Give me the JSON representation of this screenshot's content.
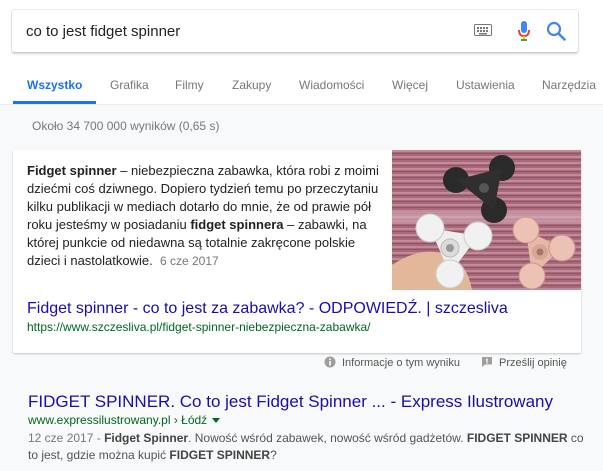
{
  "search": {
    "query": "co to jest fidget spinner"
  },
  "tabs": [
    {
      "label": "Wszystko"
    },
    {
      "label": "Grafika"
    },
    {
      "label": "Filmy"
    },
    {
      "label": "Zakupy"
    },
    {
      "label": "Wiadomości"
    },
    {
      "label": "Więcej"
    },
    {
      "label": "Ustawienia"
    },
    {
      "label": "Narzędzia"
    }
  ],
  "stats": "Około 34 700 000 wyników (0,65 s)",
  "featured": {
    "snippet_parts": {
      "b1": "Fidget spinner",
      "t1": " – niebezpieczna zabawka, która robi z moimi dziećmi coś dziwnego. Dopiero tydzień temu po przeczytaniu kilku publikacji w mediach dotarło do mnie, że od prawie pół roku jesteśmy w posiadaniu ",
      "b2": "fidget spinnera",
      "t2": " – zabawki, na której punkcie od niedawna są totalnie zakręcone polskie dzieci i nastolatkowie."
    },
    "date": "6 cze 2017",
    "title": "Fidget spinner - co to jest za zabawka? - ODPOWIEDŹ. | szczesliva",
    "url": "https://www.szczesliva.pl/fidget-spinner-niebezpieczna-zabawka/",
    "feedback_info": "Informacje o tym wyniku",
    "feedback_send": "Prześlij opinię"
  },
  "result2": {
    "title": "FIDGET SPINNER. Co to jest Fidget Spinner ... - Express Ilustrowany",
    "url": "www.expressilustrowany.pl › Łódź",
    "snippet": {
      "date": "12 cze 2017",
      "sep": " - ",
      "b1": "Fidget Spinner",
      "t1": ". Nowość wśród zabawek, nowość wśród gadżetów. ",
      "b2": "FIDGET SPINNER",
      "t2": " co to jest, gdzie można kupić ",
      "b3": "FIDGET SPINNER",
      "t3": "?"
    }
  },
  "colors": {
    "link": "#1a0dab",
    "url": "#006621",
    "accent": "#1a73e8"
  },
  "icons": [
    "keyboard-icon",
    "microphone-icon",
    "search-icon",
    "info-icon",
    "feedback-icon"
  ]
}
